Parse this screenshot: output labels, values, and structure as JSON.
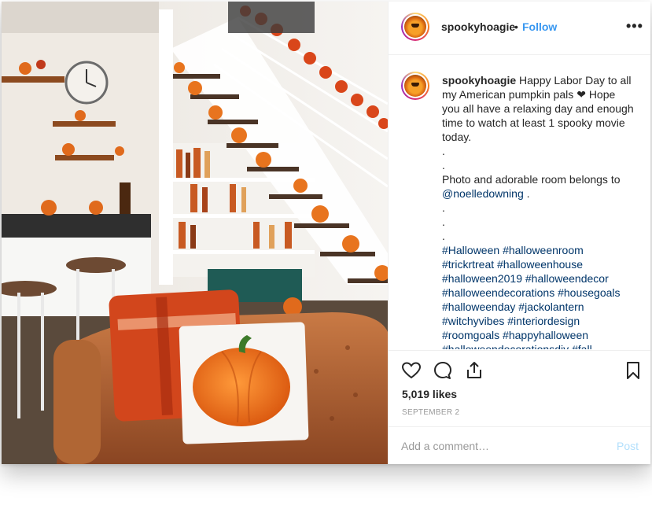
{
  "post": {
    "username": "spookyhoagie",
    "separator": "•",
    "follow_label": "Follow",
    "more_label": "•••",
    "photo_alt": "Living room decorated with pumpkins under a staircase"
  },
  "caption": {
    "username": "spookyhoagie",
    "text_1": "Happy Labor Day to all my American pumpkin pals",
    "heart": "❤",
    "text_2": "Hope you all have a relaxing day and enough time to watch at least 1 spooky movie today.",
    "dot_1": ".",
    "dot_2": ".",
    "photo_credit": "Photo and adorable room belongs to",
    "mention": "@noelledowning",
    "mention_end": ".",
    "dot_3": ".",
    "dot_4": ".",
    "dot_5": ".",
    "hashtags": [
      "#Halloween",
      "#halloweenroom",
      "#trickrtreat",
      "#halloweenhouse",
      "#halloween2019",
      "#halloweendecor",
      "#halloweendecorations",
      "#housegoals",
      "#halloweenday",
      "#jackolantern",
      "#witchyvibes",
      "#interiordesign",
      "#roomgoals",
      "#happyhalloween",
      "#halloweendecorationsdiy",
      "#fall"
    ]
  },
  "actions": {
    "like_icon": "heart-outline-icon",
    "comment_icon": "speech-bubble-icon",
    "share_icon": "share-arrow-icon",
    "save_icon": "bookmark-icon",
    "likes_text": "5,019 likes",
    "date_text": "SEPTEMBER 2"
  },
  "comment": {
    "placeholder": "Add a comment…",
    "post_label": "Post"
  },
  "colors": {
    "follow": "#3897f0",
    "link": "#003569",
    "muted": "#999999",
    "post_disabled": "#b2dffc",
    "border": "#efefef"
  }
}
